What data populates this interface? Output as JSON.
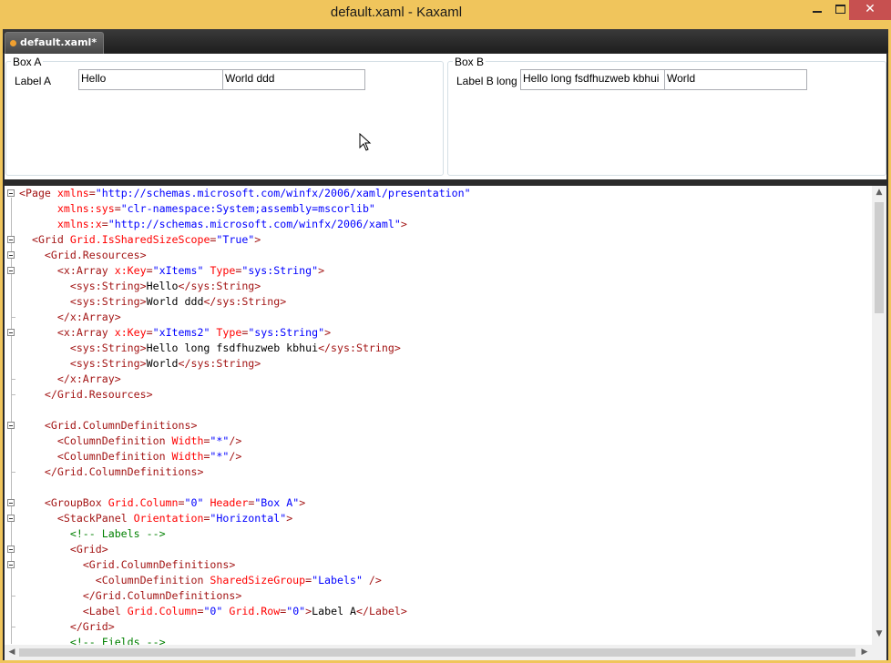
{
  "window": {
    "title": "default.xaml - Kaxaml"
  },
  "tabs": [
    {
      "label": "default.xaml*"
    }
  ],
  "preview": {
    "box_a": {
      "header": "Box A",
      "label": "Label A",
      "fields": [
        "Hello",
        "World ddd"
      ]
    },
    "box_b": {
      "header": "Box B",
      "label": "Label B long",
      "fields": [
        "Hello long fsdfhuzweb kbhui",
        "World"
      ]
    }
  },
  "editor": {
    "lines": [
      [
        [
          "tag",
          "<Page "
        ],
        [
          "attr",
          "xmlns"
        ],
        [
          "tag",
          "="
        ],
        [
          "val",
          "\"http://schemas.microsoft.com/winfx/2006/xaml/presentation\""
        ]
      ],
      [
        [
          "txt",
          "      "
        ],
        [
          "attr",
          "xmlns:sys"
        ],
        [
          "tag",
          "="
        ],
        [
          "val",
          "\"clr-namespace:System;assembly=mscorlib\""
        ]
      ],
      [
        [
          "txt",
          "      "
        ],
        [
          "attr",
          "xmlns:x"
        ],
        [
          "tag",
          "="
        ],
        [
          "val",
          "\"http://schemas.microsoft.com/winfx/2006/xaml\""
        ],
        [
          "tag",
          ">"
        ]
      ],
      [
        [
          "txt",
          "  "
        ],
        [
          "tag",
          "<Grid "
        ],
        [
          "attr",
          "Grid.IsSharedSizeScope"
        ],
        [
          "tag",
          "="
        ],
        [
          "val",
          "\"True\""
        ],
        [
          "tag",
          ">"
        ]
      ],
      [
        [
          "txt",
          "    "
        ],
        [
          "tag",
          "<Grid.Resources>"
        ]
      ],
      [
        [
          "txt",
          "      "
        ],
        [
          "tag",
          "<x:Array "
        ],
        [
          "attr",
          "x:Key"
        ],
        [
          "tag",
          "="
        ],
        [
          "val",
          "\"xItems\""
        ],
        [
          "txt",
          " "
        ],
        [
          "attr",
          "Type"
        ],
        [
          "tag",
          "="
        ],
        [
          "val",
          "\"sys:String\""
        ],
        [
          "tag",
          ">"
        ]
      ],
      [
        [
          "txt",
          "        "
        ],
        [
          "tag",
          "<sys:String>"
        ],
        [
          "txt",
          "Hello"
        ],
        [
          "tag",
          "</sys:String>"
        ]
      ],
      [
        [
          "txt",
          "        "
        ],
        [
          "tag",
          "<sys:String>"
        ],
        [
          "txt",
          "World ddd"
        ],
        [
          "tag",
          "</sys:String>"
        ]
      ],
      [
        [
          "txt",
          "      "
        ],
        [
          "tag",
          "</x:Array>"
        ]
      ],
      [
        [
          "txt",
          "      "
        ],
        [
          "tag",
          "<x:Array "
        ],
        [
          "attr",
          "x:Key"
        ],
        [
          "tag",
          "="
        ],
        [
          "val",
          "\"xItems2\""
        ],
        [
          "txt",
          " "
        ],
        [
          "attr",
          "Type"
        ],
        [
          "tag",
          "="
        ],
        [
          "val",
          "\"sys:String\""
        ],
        [
          "tag",
          ">"
        ]
      ],
      [
        [
          "txt",
          "        "
        ],
        [
          "tag",
          "<sys:String>"
        ],
        [
          "txt",
          "Hello long fsdfhuzweb kbhui"
        ],
        [
          "tag",
          "</sys:String>"
        ]
      ],
      [
        [
          "txt",
          "        "
        ],
        [
          "tag",
          "<sys:String>"
        ],
        [
          "txt",
          "World"
        ],
        [
          "tag",
          "</sys:String>"
        ]
      ],
      [
        [
          "txt",
          "      "
        ],
        [
          "tag",
          "</x:Array>"
        ]
      ],
      [
        [
          "txt",
          "    "
        ],
        [
          "tag",
          "</Grid.Resources>"
        ]
      ],
      [
        [
          "txt",
          ""
        ]
      ],
      [
        [
          "txt",
          "    "
        ],
        [
          "tag",
          "<Grid.ColumnDefinitions>"
        ]
      ],
      [
        [
          "txt",
          "      "
        ],
        [
          "tag",
          "<ColumnDefinition "
        ],
        [
          "attr",
          "Width"
        ],
        [
          "tag",
          "="
        ],
        [
          "val",
          "\"*\""
        ],
        [
          "tag",
          "/>"
        ]
      ],
      [
        [
          "txt",
          "      "
        ],
        [
          "tag",
          "<ColumnDefinition "
        ],
        [
          "attr",
          "Width"
        ],
        [
          "tag",
          "="
        ],
        [
          "val",
          "\"*\""
        ],
        [
          "tag",
          "/>"
        ]
      ],
      [
        [
          "txt",
          "    "
        ],
        [
          "tag",
          "</Grid.ColumnDefinitions>"
        ]
      ],
      [
        [
          "txt",
          ""
        ]
      ],
      [
        [
          "txt",
          "    "
        ],
        [
          "tag",
          "<GroupBox "
        ],
        [
          "attr",
          "Grid.Column"
        ],
        [
          "tag",
          "="
        ],
        [
          "val",
          "\"0\""
        ],
        [
          "txt",
          " "
        ],
        [
          "attr",
          "Header"
        ],
        [
          "tag",
          "="
        ],
        [
          "val",
          "\"Box A\""
        ],
        [
          "tag",
          ">"
        ]
      ],
      [
        [
          "txt",
          "      "
        ],
        [
          "tag",
          "<StackPanel "
        ],
        [
          "attr",
          "Orientation"
        ],
        [
          "tag",
          "="
        ],
        [
          "val",
          "\"Horizontal\""
        ],
        [
          "tag",
          ">"
        ]
      ],
      [
        [
          "txt",
          "        "
        ],
        [
          "cmt",
          "<!-- Labels -->"
        ]
      ],
      [
        [
          "txt",
          "        "
        ],
        [
          "tag",
          "<Grid>"
        ]
      ],
      [
        [
          "txt",
          "          "
        ],
        [
          "tag",
          "<Grid.ColumnDefinitions>"
        ]
      ],
      [
        [
          "txt",
          "            "
        ],
        [
          "tag",
          "<ColumnDefinition "
        ],
        [
          "attr",
          "SharedSizeGroup"
        ],
        [
          "tag",
          "="
        ],
        [
          "val",
          "\"Labels\""
        ],
        [
          "txt",
          " "
        ],
        [
          "tag",
          "/>"
        ]
      ],
      [
        [
          "txt",
          "          "
        ],
        [
          "tag",
          "</Grid.ColumnDefinitions>"
        ]
      ],
      [
        [
          "txt",
          "          "
        ],
        [
          "tag",
          "<Label "
        ],
        [
          "attr",
          "Grid.Column"
        ],
        [
          "tag",
          "="
        ],
        [
          "val",
          "\"0\""
        ],
        [
          "txt",
          " "
        ],
        [
          "attr",
          "Grid.Row"
        ],
        [
          "tag",
          "="
        ],
        [
          "val",
          "\"0\""
        ],
        [
          "tag",
          ">"
        ],
        [
          "txt",
          "Label A"
        ],
        [
          "tag",
          "</Label>"
        ]
      ],
      [
        [
          "txt",
          "        "
        ],
        [
          "tag",
          "</Grid>"
        ]
      ],
      [
        [
          "txt",
          "        "
        ],
        [
          "cmt",
          "<!-- Fields -->"
        ]
      ]
    ]
  },
  "colors": {
    "titlebar": "#f0c55c",
    "tag": "#a31515",
    "attribute": "#ff0000",
    "value": "#0000ff",
    "comment": "#008000"
  },
  "icons": {
    "minimize": "minimize-icon",
    "maximize": "maximize-icon",
    "close": "close-icon"
  }
}
